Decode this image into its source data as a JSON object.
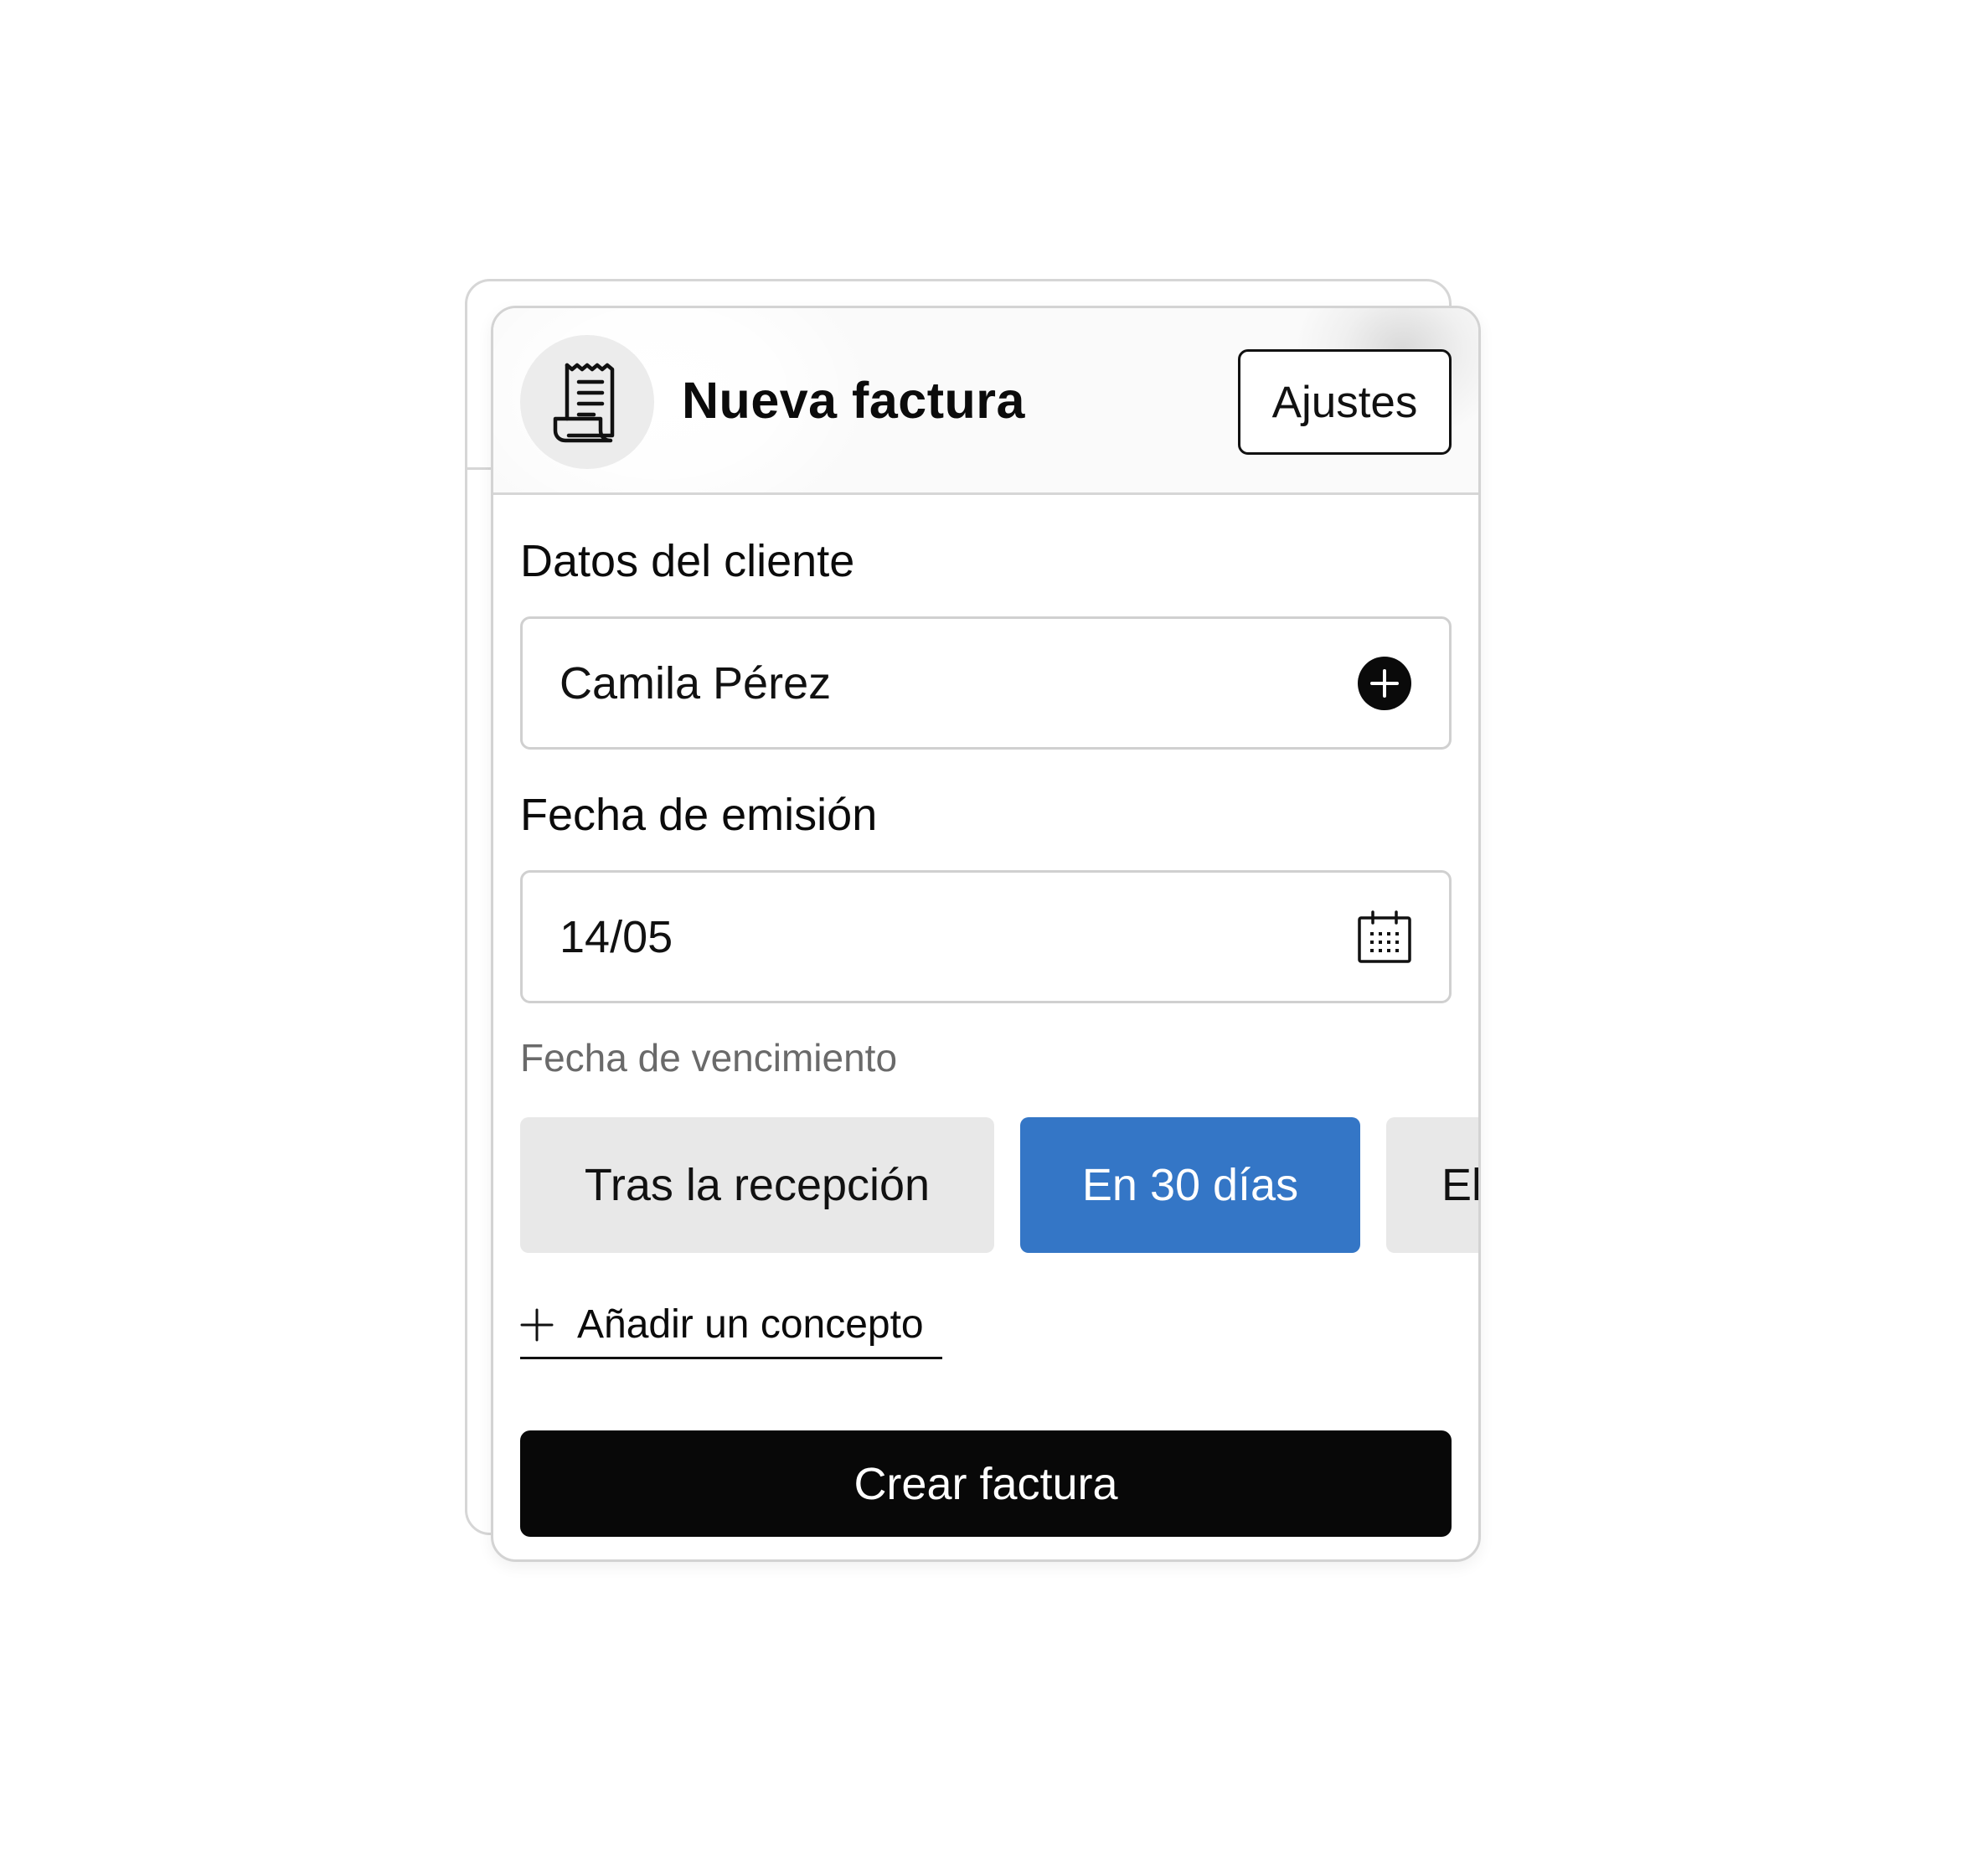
{
  "header": {
    "title": "Nueva factura",
    "settings_label": "Ajustes",
    "icon": "receipt-icon"
  },
  "client": {
    "label": "Datos del cliente",
    "value": "Camila Pérez",
    "icon": "add-circle-icon"
  },
  "issue_date": {
    "label": "Fecha de emisión",
    "value": "14/05",
    "icon": "calendar-icon"
  },
  "due_date": {
    "label": "Fecha de vencimiento",
    "options": [
      {
        "label": "Tras la recepción",
        "selected": false
      },
      {
        "label": "En 30 días",
        "selected": true
      },
      {
        "label": "El",
        "selected": false
      }
    ]
  },
  "add_item": {
    "label": "Añadir un concepto",
    "icon": "plus-icon"
  },
  "create_button": {
    "label": "Crear factura"
  },
  "colors": {
    "accent": "#3476c6",
    "primary_button": "#080808",
    "chip_background": "#e8e8e8",
    "border": "#d0d0d0"
  }
}
